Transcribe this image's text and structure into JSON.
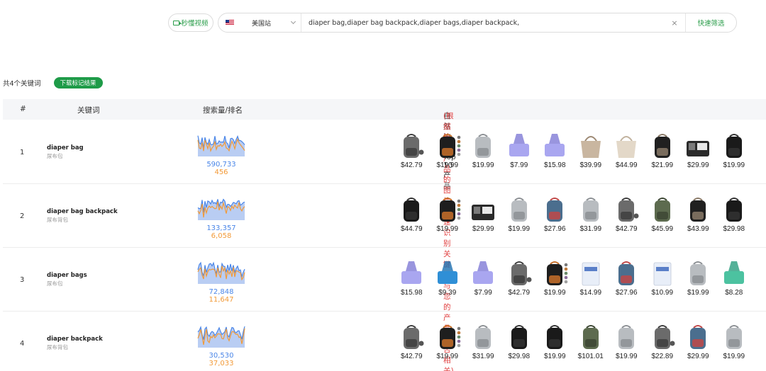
{
  "toolbar": {
    "video_label": "秒懂视频",
    "site_label": "美国站",
    "search_value": "diaper bag,diaper bag backpack,diaper bags,diaper backpack,",
    "clear_label": "×",
    "quick_filter_label": "快速筛选"
  },
  "summary": {
    "count_label": "共4个关键词",
    "download_label": "下载标记结果"
  },
  "table": {
    "headers": {
      "no": "#",
      "keyword": "关键词",
      "volume": "搜索量/排名",
      "top_main": "自然流量Top 10产品",
      "top_note": "(根据热销产品的图片快速识别关键词与您的产品是否相关)"
    },
    "rows": [
      {
        "no": "1",
        "keyword": "diaper bag",
        "keyword_cn": "尿布包",
        "volume": "590,733",
        "rank": "456",
        "products": [
          {
            "price": "$42.79",
            "img": "backpack-gray"
          },
          {
            "price": "$19.99",
            "img": "backpack-black-swatch"
          },
          {
            "price": "$19.99",
            "img": "backpack-lightgray"
          },
          {
            "price": "$7.99",
            "img": "bag-roll-purple"
          },
          {
            "price": "$15.98",
            "img": "bag-roll-purple"
          },
          {
            "price": "$39.99",
            "img": "tote-beige"
          },
          {
            "price": "$44.99",
            "img": "tote-cream"
          },
          {
            "price": "$21.99",
            "img": "backpack-black-bottles"
          },
          {
            "price": "$29.99",
            "img": "caddy-black"
          },
          {
            "price": "$19.99",
            "img": "backpack-black"
          }
        ]
      },
      {
        "no": "2",
        "keyword": "diaper bag backpack",
        "keyword_cn": "尿布背包",
        "volume": "133,357",
        "rank": "6,058",
        "products": [
          {
            "price": "$44.79",
            "img": "backpack-black"
          },
          {
            "price": "$19.99",
            "img": "backpack-black-swatch"
          },
          {
            "price": "$29.99",
            "img": "caddy-black"
          },
          {
            "price": "$19.99",
            "img": "backpack-lightgray"
          },
          {
            "price": "$27.96",
            "img": "backpack-multicolor"
          },
          {
            "price": "$31.99",
            "img": "backpack-lightgray"
          },
          {
            "price": "$42.79",
            "img": "backpack-gray"
          },
          {
            "price": "$45.99",
            "img": "backpack-olive"
          },
          {
            "price": "$43.99",
            "img": "backpack-black-bottles"
          },
          {
            "price": "$29.98",
            "img": "backpack-black"
          }
        ]
      },
      {
        "no": "3",
        "keyword": "diaper bags",
        "keyword_cn": "尿布包",
        "volume": "72,848",
        "rank": "11,647",
        "products": [
          {
            "price": "$15.98",
            "img": "bag-roll-purple"
          },
          {
            "price": "$9.39",
            "img": "bag-roll-blue"
          },
          {
            "price": "$7.99",
            "img": "bag-roll-purple"
          },
          {
            "price": "$42.79",
            "img": "backpack-gray"
          },
          {
            "price": "$19.99",
            "img": "backpack-black-swatch"
          },
          {
            "price": "$14.99",
            "img": "box-white"
          },
          {
            "price": "$27.96",
            "img": "backpack-multicolor"
          },
          {
            "price": "$10.99",
            "img": "box-white"
          },
          {
            "price": "$19.99",
            "img": "backpack-lightgray"
          },
          {
            "price": "$8.28",
            "img": "bag-roll-green"
          }
        ]
      },
      {
        "no": "4",
        "keyword": "diaper backpack",
        "keyword_cn": "尿布背包",
        "volume": "30,530",
        "rank": "37,033",
        "products": [
          {
            "price": "$42.79",
            "img": "backpack-gray"
          },
          {
            "price": "$19.99",
            "img": "backpack-black-swatch"
          },
          {
            "price": "$31.99",
            "img": "backpack-lightgray"
          },
          {
            "price": "$29.98",
            "img": "backpack-black"
          },
          {
            "price": "$19.99",
            "img": "backpack-black"
          },
          {
            "price": "$101.01",
            "img": "backpack-olive"
          },
          {
            "price": "$19.99",
            "img": "backpack-lightgray"
          },
          {
            "price": "$22.89",
            "img": "backpack-gray"
          },
          {
            "price": "$29.99",
            "img": "backpack-multicolor"
          },
          {
            "price": "$19.99",
            "img": "backpack-lightgray"
          }
        ]
      }
    ]
  }
}
